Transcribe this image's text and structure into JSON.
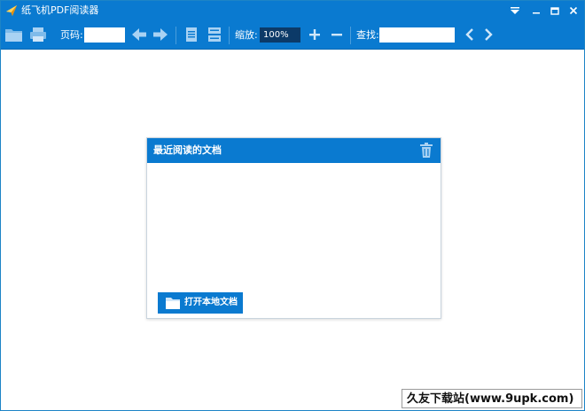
{
  "window": {
    "title": "纸飞机PDF阅读器",
    "logo_icon": "paper-plane-icon"
  },
  "title_bar": {
    "buttons": [
      "dropdown-menu-icon",
      "minimize-icon",
      "maximize-icon",
      "close-icon"
    ]
  },
  "toolbar": {
    "page_label": "页码:",
    "page_value": "",
    "zoom_label": "缩放:",
    "zoom_value": "100%",
    "find_label": "查找:",
    "find_value": "",
    "icons": [
      "open-folder-icon",
      "print-icon",
      "previous-page-icon",
      "next-page-icon",
      "single-page-view-icon",
      "continuous-view-icon",
      "zoom-in-icon",
      "zoom-out-icon",
      "find-previous-icon",
      "find-next-icon"
    ]
  },
  "recent_panel": {
    "title": "最近阅读的文档",
    "items": [],
    "open_local_label": "打开本地文档",
    "delete_icon": "trash-icon"
  },
  "watermark": {
    "text": "久友下载站(www.9upk.com)"
  },
  "colors": {
    "accent": "#0a7ad0",
    "zoom_field_bg": "#0c3a68",
    "background": "#ffffff"
  }
}
